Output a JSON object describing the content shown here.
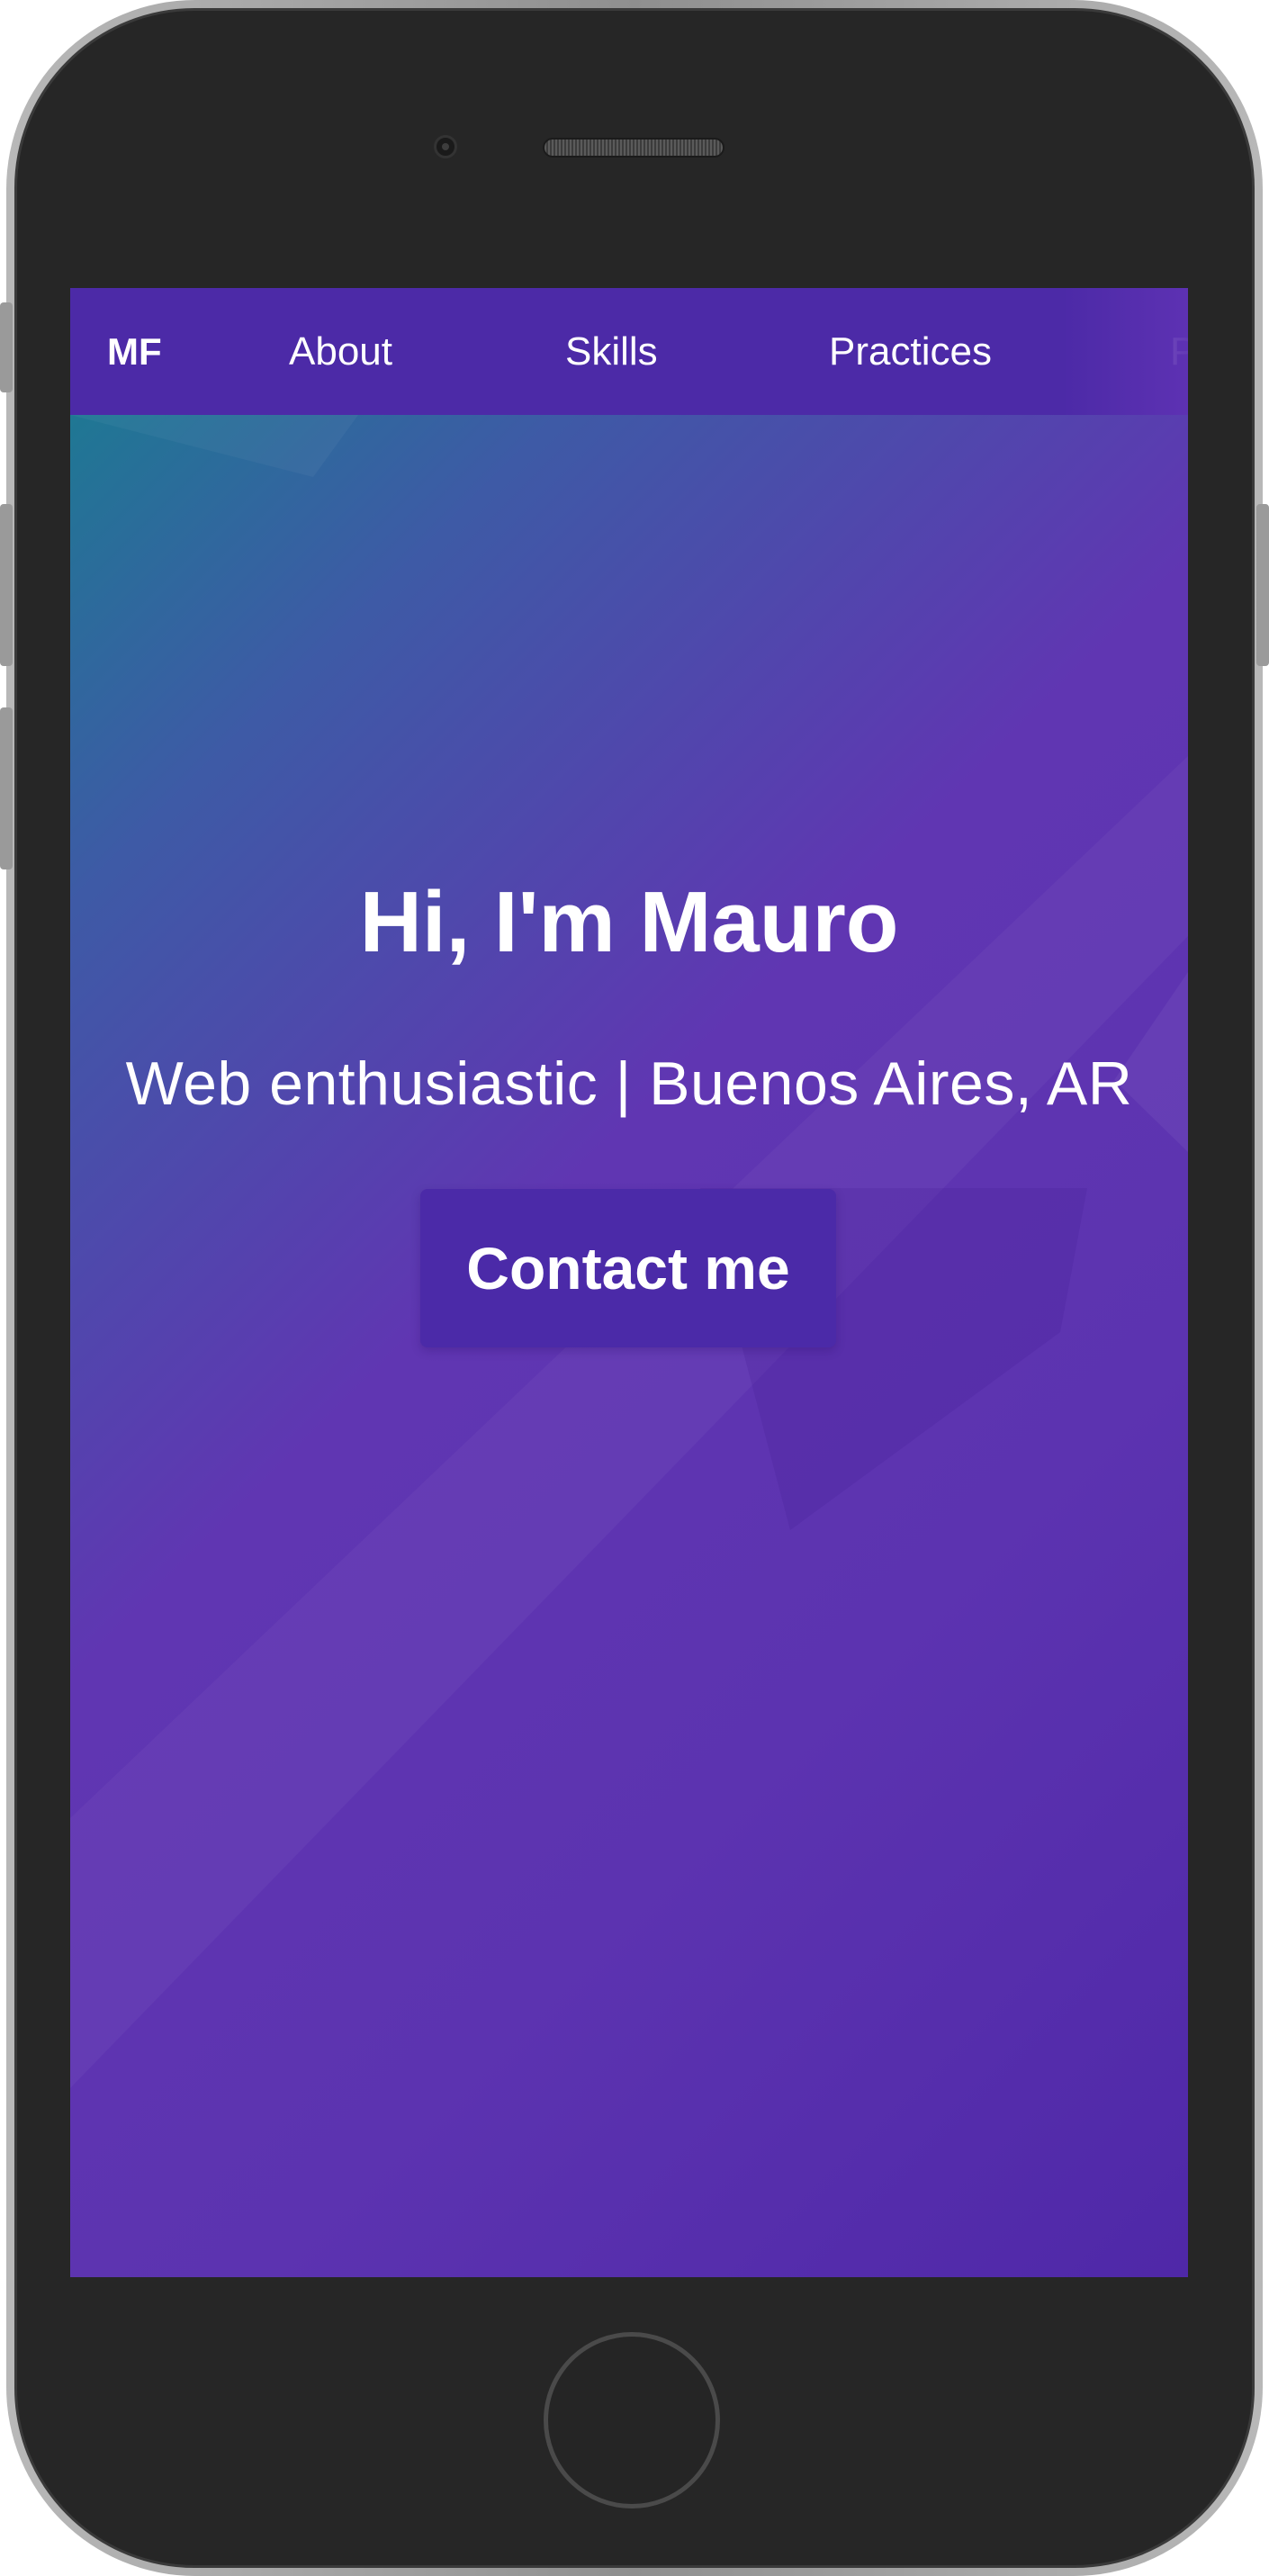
{
  "navbar": {
    "brand": "MF",
    "links": [
      {
        "label": "About"
      },
      {
        "label": "Skills"
      },
      {
        "label": "Practices"
      },
      {
        "label": "P"
      }
    ]
  },
  "hero": {
    "title": "Hi, I'm Mauro",
    "subtitle": "Web enthusiastic | Buenos Aires, AR",
    "cta_label": "Contact me"
  },
  "colors": {
    "navbar_bg": "#4c2aa7",
    "gradient_start": "#177f8f",
    "gradient_mid": "#6036b2",
    "gradient_end": "#4f28a8",
    "cta_bg": "#4b2aa8",
    "text": "#ffffff"
  },
  "device": {
    "type": "phone-frame",
    "icons": [
      "camera-icon",
      "speaker-icon",
      "home-button-icon"
    ]
  }
}
